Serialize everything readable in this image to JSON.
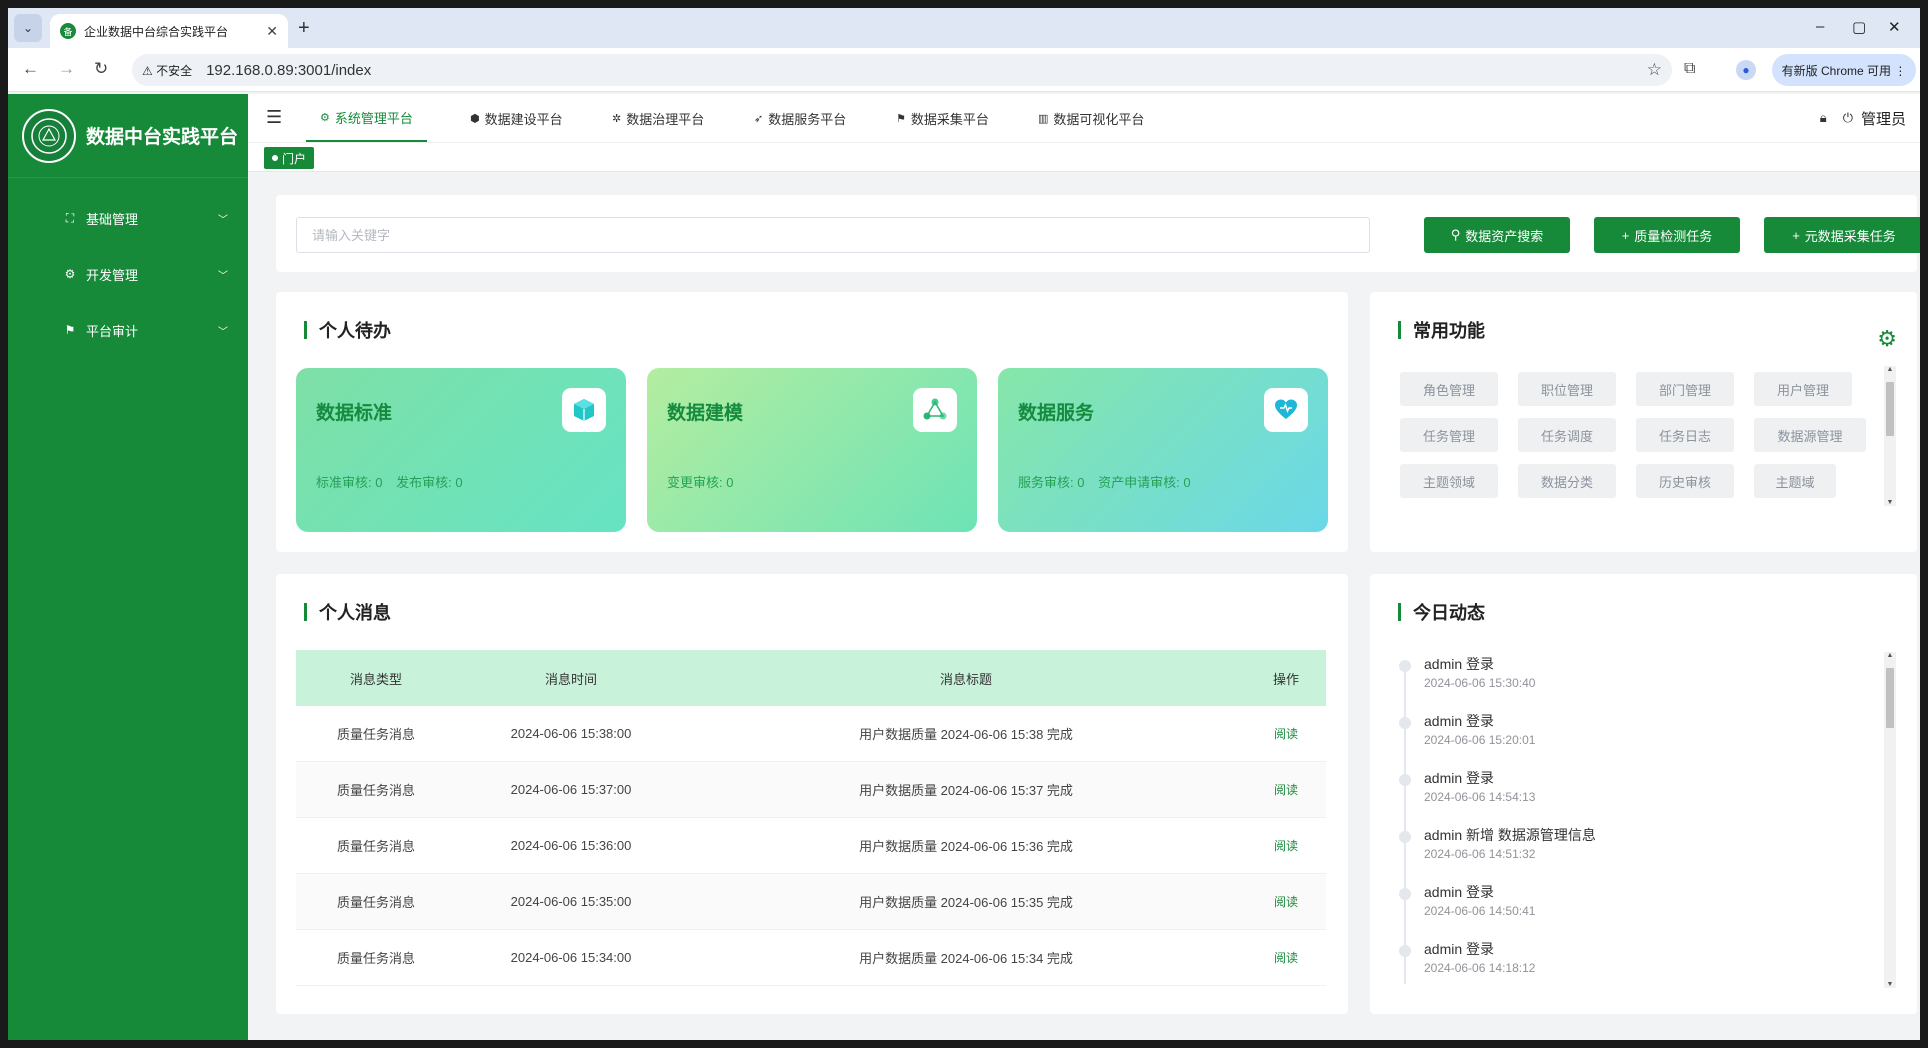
{
  "browser": {
    "tab_title": "企业数据中台综合实践平台",
    "tab_favicon": "备",
    "new_tab": "+",
    "insecure_label": "⚠ 不安全",
    "url": "192.168.0.89:3001/index",
    "update_label": "有新版 Chrome 可用 ⋮",
    "minimize": "–",
    "maximize": "▢",
    "close": "✕"
  },
  "brand": {
    "title": "数据中台实践平台"
  },
  "sidebar": {
    "items": [
      {
        "label": "基础管理",
        "icon": "grid-icon"
      },
      {
        "label": "开发管理",
        "icon": "gear-icon"
      },
      {
        "label": "平台审计",
        "icon": "flag-icon"
      }
    ]
  },
  "topnav": {
    "tabs": [
      {
        "label": "系统管理平台",
        "icon": "⚙"
      },
      {
        "label": "数据建设平台",
        "icon": "⬢"
      },
      {
        "label": "数据治理平台",
        "icon": "✲"
      },
      {
        "label": "数据服务平台",
        "icon": "➶"
      },
      {
        "label": "数据采集平台",
        "icon": "⚑"
      },
      {
        "label": "数据可视化平台",
        "icon": "▥"
      }
    ],
    "user": "管理员"
  },
  "tags": {
    "portal": "门户"
  },
  "search": {
    "placeholder": "请输入关键字",
    "btn_search": "数据资产搜索",
    "btn_quality": "质量检测任务",
    "btn_meta": "元数据采集任务"
  },
  "todo": {
    "title": "个人待办",
    "boxes": [
      {
        "name": "数据标准",
        "stats": [
          "标准审核: 0",
          "发布审核: 0"
        ],
        "icon": "cube-icon"
      },
      {
        "name": "数据建模",
        "stats": [
          "变更审核: 0"
        ],
        "icon": "network-icon"
      },
      {
        "name": "数据服务",
        "stats": [
          "服务审核: 0",
          "资产申请审核: 0"
        ],
        "icon": "heart-icon"
      }
    ]
  },
  "functions": {
    "title": "常用功能",
    "items": [
      "角色管理",
      "职位管理",
      "部门管理",
      "用户管理",
      "任务管理",
      "任务调度",
      "任务日志",
      "数据源管理",
      "主题领域",
      "数据分类",
      "历史审核",
      "主题域"
    ]
  },
  "messages": {
    "title": "个人消息",
    "headers": [
      "消息类型",
      "消息时间",
      "消息标题",
      "操作"
    ],
    "rows": [
      {
        "type": "质量任务消息",
        "time": "2024-06-06 15:38:00",
        "subject": "用户数据质量 2024-06-06 15:38 完成",
        "action": "阅读"
      },
      {
        "type": "质量任务消息",
        "time": "2024-06-06 15:37:00",
        "subject": "用户数据质量 2024-06-06 15:37 完成",
        "action": "阅读"
      },
      {
        "type": "质量任务消息",
        "time": "2024-06-06 15:36:00",
        "subject": "用户数据质量 2024-06-06 15:36 完成",
        "action": "阅读"
      },
      {
        "type": "质量任务消息",
        "time": "2024-06-06 15:35:00",
        "subject": "用户数据质量 2024-06-06 15:35 完成",
        "action": "阅读"
      },
      {
        "type": "质量任务消息",
        "time": "2024-06-06 15:34:00",
        "subject": "用户数据质量 2024-06-06 15:34 完成",
        "action": "阅读"
      }
    ]
  },
  "activity": {
    "title": "今日动态",
    "items": [
      {
        "text": "admin 登录",
        "time": "2024-06-06 15:30:40"
      },
      {
        "text": "admin 登录",
        "time": "2024-06-06 15:20:01"
      },
      {
        "text": "admin 登录",
        "time": "2024-06-06 14:54:13"
      },
      {
        "text": "admin 新增 数据源管理信息",
        "time": "2024-06-06 14:51:32"
      },
      {
        "text": "admin 登录",
        "time": "2024-06-06 14:50:41"
      },
      {
        "text": "admin 登录",
        "time": "2024-06-06 14:18:12"
      }
    ]
  },
  "colors": {
    "brand_green": "#178a3a",
    "table_header": "#c9f2da"
  }
}
